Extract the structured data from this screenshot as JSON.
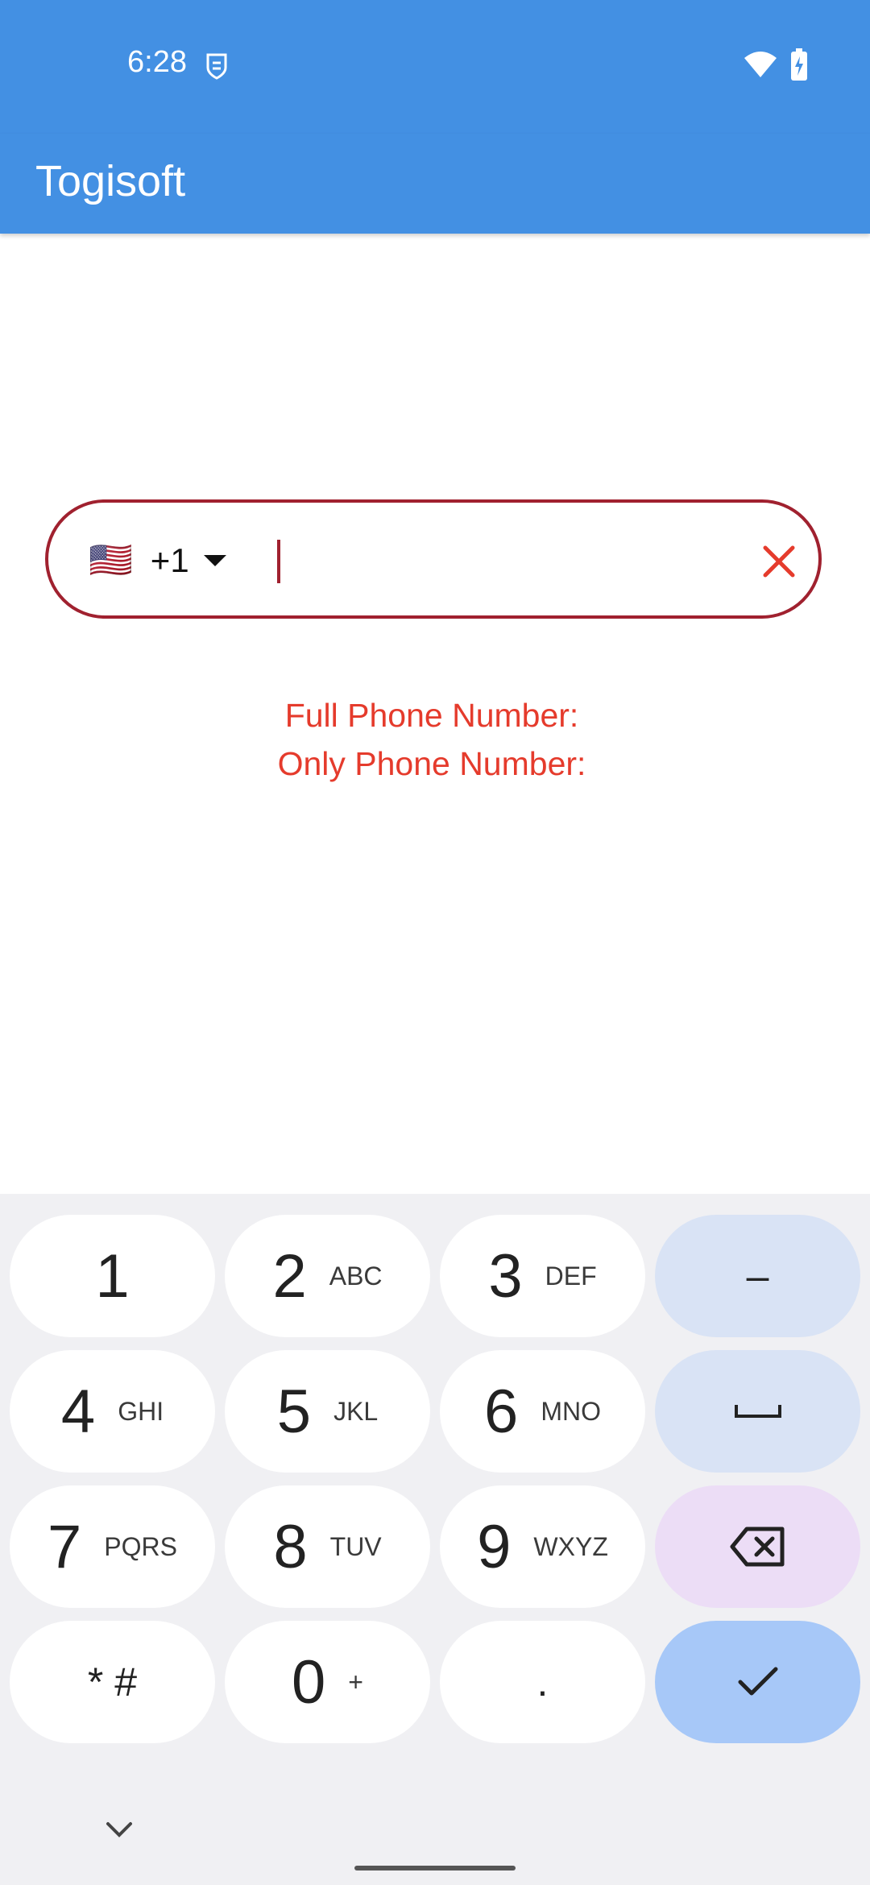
{
  "status_bar": {
    "time": "6:28",
    "icons": [
      "shield-icon",
      "wifi-icon",
      "battery-charging-icon"
    ]
  },
  "app_bar": {
    "title": "Togisoft"
  },
  "phone_field": {
    "flag": "🇺🇸",
    "dial_code": "+1",
    "value": "",
    "placeholder": "",
    "clear_icon": "close-icon",
    "border_color": "#A0212F",
    "clear_color": "#E53B2C"
  },
  "labels": {
    "full_phone": "Full Phone Number:",
    "only_phone": "Only Phone Number:"
  },
  "keyboard": {
    "keys": [
      {
        "digit": "1",
        "letters": ""
      },
      {
        "digit": "2",
        "letters": "ABC"
      },
      {
        "digit": "3",
        "letters": "DEF"
      },
      {
        "digit": "4",
        "letters": "GHI"
      },
      {
        "digit": "5",
        "letters": "JKL"
      },
      {
        "digit": "6",
        "letters": "MNO"
      },
      {
        "digit": "7",
        "letters": "PQRS"
      },
      {
        "digit": "8",
        "letters": "TUV"
      },
      {
        "digit": "9",
        "letters": "WXYZ"
      },
      {
        "digit": "* #",
        "letters": ""
      },
      {
        "digit": "0",
        "letters": "+"
      },
      {
        "digit": ".",
        "letters": ""
      }
    ],
    "function_keys": [
      "minus-key",
      "space-key",
      "backspace-key",
      "done-key"
    ],
    "minus_label": "–"
  },
  "colors": {
    "accent": "#4390E3",
    "keyboard_bg": "#F0F0F3",
    "error_text": "#E53B2C"
  }
}
